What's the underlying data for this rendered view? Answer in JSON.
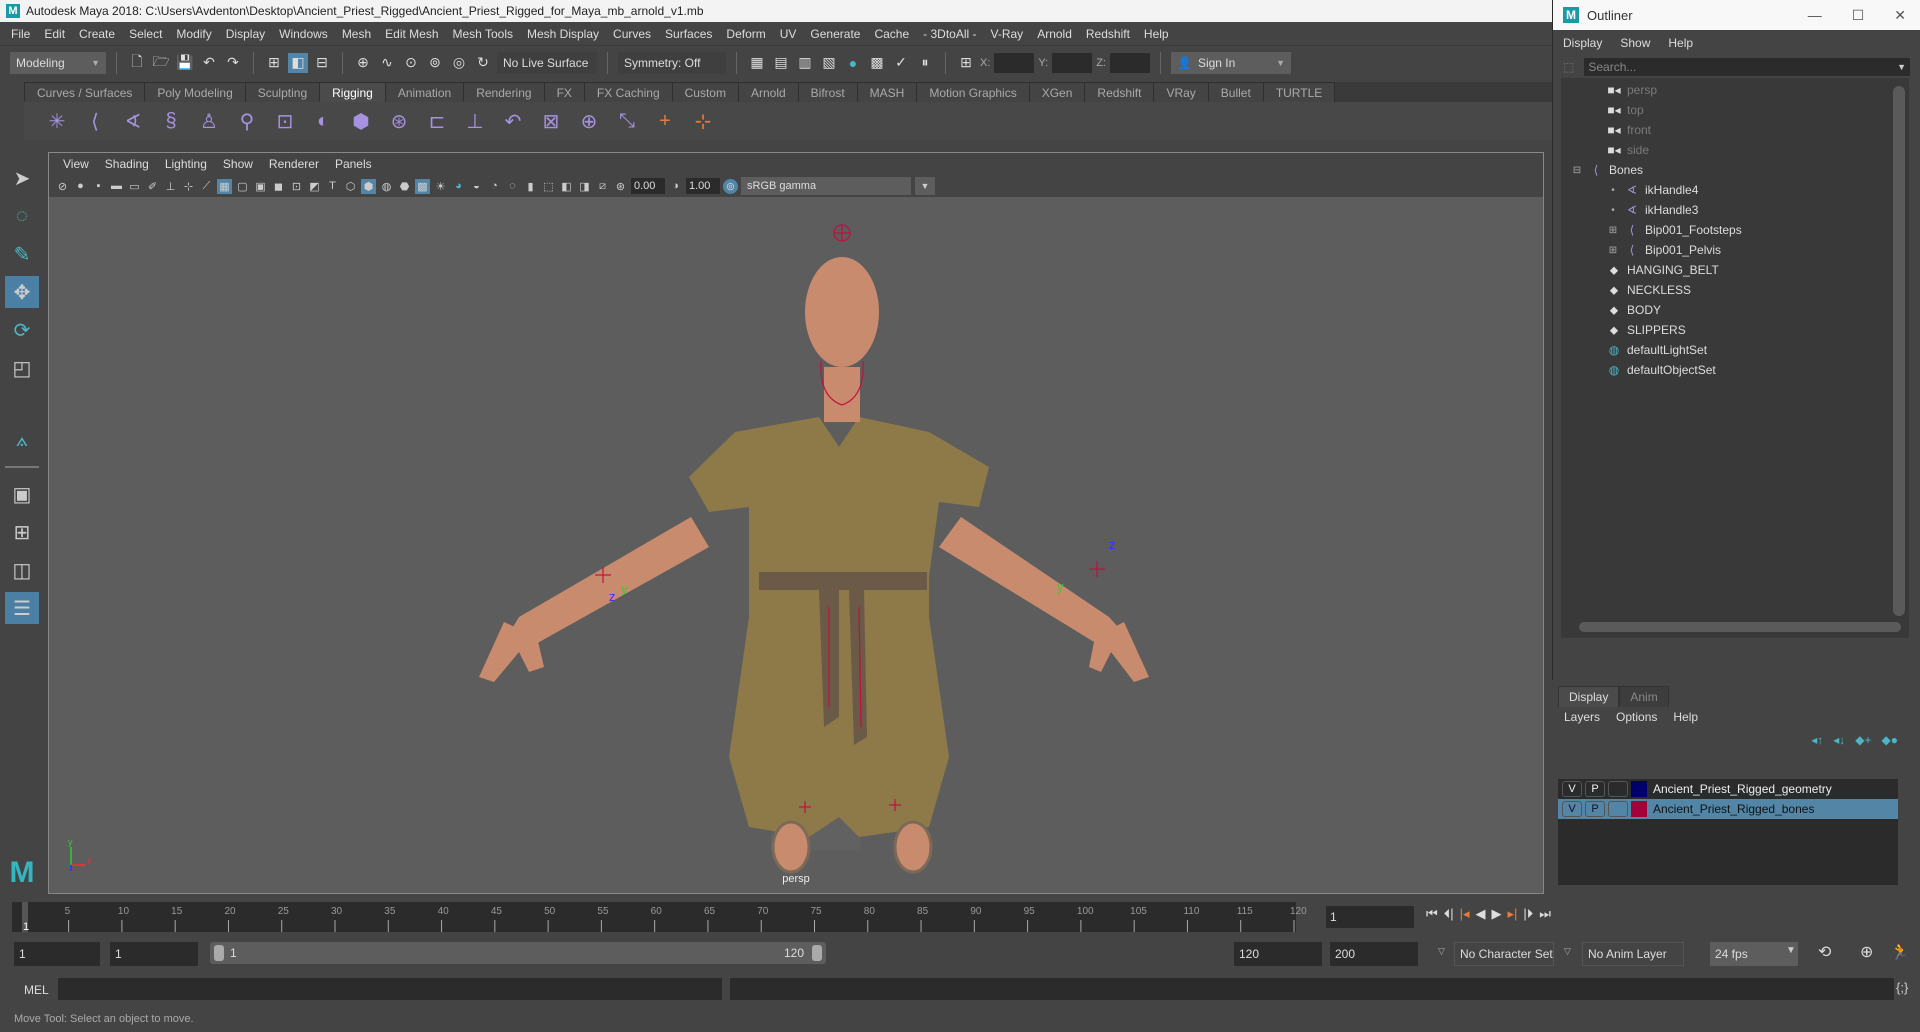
{
  "window": {
    "title": "Autodesk Maya 2018: C:\\Users\\Avdenton\\Desktop\\Ancient_Priest_Rigged\\Ancient_Priest_Rigged_for_Maya_mb_arnold_v1.mb"
  },
  "menubar": [
    "File",
    "Edit",
    "Create",
    "Select",
    "Modify",
    "Display",
    "Windows",
    "Mesh",
    "Edit Mesh",
    "Mesh Tools",
    "Mesh Display",
    "Curves",
    "Surfaces",
    "Deform",
    "UV",
    "Generate",
    "Cache",
    "- 3DtoAll -",
    "V-Ray",
    "Arnold",
    "Redshift",
    "Help"
  ],
  "statusline": {
    "menuset": "Modeling",
    "live_surface": "No Live Surface",
    "symmetry": "Symmetry: Off",
    "x_label": "X:",
    "y_label": "Y:",
    "z_label": "Z:",
    "sign_in": "Sign In"
  },
  "shelf": {
    "tabs": [
      "Curves / Surfaces",
      "Poly Modeling",
      "Sculpting",
      "Rigging",
      "Animation",
      "Rendering",
      "FX",
      "FX Caching",
      "Custom",
      "Arnold",
      "Bifrost",
      "MASH",
      "Motion Graphics",
      "XGen",
      "Redshift",
      "VRay",
      "Bullet",
      "TURTLE"
    ],
    "active_tab": "Rigging"
  },
  "viewport": {
    "menu": [
      "View",
      "Shading",
      "Lighting",
      "Show",
      "Renderer",
      "Panels"
    ],
    "exposure": "0.00",
    "gamma": "1.00",
    "color_space": "sRGB gamma",
    "camera_label": "persp"
  },
  "outliner": {
    "title": "Outliner",
    "menu": [
      "Display",
      "Show",
      "Help"
    ],
    "search_placeholder": "Search...",
    "items": [
      {
        "label": "persp",
        "icon": "camera-icon",
        "depth": 1,
        "dim": true
      },
      {
        "label": "top",
        "icon": "camera-icon",
        "depth": 1,
        "dim": true
      },
      {
        "label": "front",
        "icon": "camera-icon",
        "depth": 1,
        "dim": true
      },
      {
        "label": "side",
        "icon": "camera-icon",
        "depth": 1,
        "dim": true
      },
      {
        "label": "Bones",
        "icon": "joint-icon",
        "depth": 0,
        "expander": "−"
      },
      {
        "label": "ikHandle4",
        "icon": "ik-handle-icon",
        "depth": 2
      },
      {
        "label": "ikHandle3",
        "icon": "ik-handle-icon",
        "depth": 2
      },
      {
        "label": "Bip001_Footsteps",
        "icon": "joint-icon",
        "depth": 2,
        "expander": "+"
      },
      {
        "label": "Bip001_Pelvis",
        "icon": "joint-icon",
        "depth": 2,
        "expander": "+"
      },
      {
        "label": "HANGING_BELT",
        "icon": "mesh-icon",
        "depth": 1
      },
      {
        "label": "NECKLESS",
        "icon": "mesh-icon",
        "depth": 1
      },
      {
        "label": "BODY",
        "icon": "mesh-icon",
        "depth": 1
      },
      {
        "label": "SLIPPERS",
        "icon": "mesh-icon",
        "depth": 1
      },
      {
        "label": "defaultLightSet",
        "icon": "set-icon",
        "depth": 1
      },
      {
        "label": "defaultObjectSet",
        "icon": "set-icon",
        "depth": 1
      }
    ]
  },
  "layer_editor": {
    "tabs": [
      "Display",
      "Anim"
    ],
    "menu": [
      "Layers",
      "Options",
      "Help"
    ],
    "layers": [
      {
        "v": "V",
        "p": "P",
        "name": "Ancient_Priest_Rigged_geometry",
        "color": "#00006b",
        "selected": false
      },
      {
        "v": "V",
        "p": "P",
        "name": "Ancient_Priest_Rigged_bones",
        "color": "#a5003a",
        "selected": true
      }
    ]
  },
  "timeline": {
    "ticks": [
      "5",
      "10",
      "15",
      "20",
      "25",
      "30",
      "35",
      "40",
      "45",
      "50",
      "55",
      "60",
      "65",
      "70",
      "75",
      "80",
      "85",
      "90",
      "95",
      "100",
      "105",
      "110",
      "115",
      "120"
    ],
    "current_marker": "1",
    "current_frame": "1"
  },
  "range": {
    "start": "1",
    "anim_start": "1",
    "slider_start": "1",
    "slider_end": "120",
    "end": "120",
    "anim_end": "200",
    "character_set": "No Character Set",
    "anim_layer": "No Anim Layer",
    "fps": "24 fps"
  },
  "command_line": {
    "label": "MEL"
  },
  "help_line": "Move Tool: Select an object to move."
}
